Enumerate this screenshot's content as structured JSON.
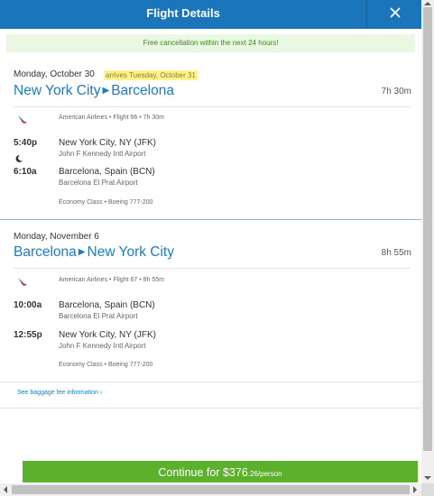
{
  "header": {
    "title": "Flight Details",
    "close_icon": "close-icon"
  },
  "banner": {
    "text": "Free cancellation within the next 24 hours!"
  },
  "outbound": {
    "date": "Monday, October 30",
    "arrives": "arrives Tuesday, October 31",
    "from": "New York City",
    "to": "Barcelona",
    "duration": "7h 30m",
    "airline": "American Airlines • Flight 66 • 7h 30m",
    "depart_time": "5:40p",
    "depart_city": "New York City, NY (JFK)",
    "depart_airport": "John F Kennedy Intl Airport",
    "arrive_time": "6:10a",
    "arrive_city": "Barcelona, Spain (BCN)",
    "arrive_airport": "Barcelona El Prat Airport",
    "cabin": "Economy Class • Boeing 777-200"
  },
  "return": {
    "date": "Monday, November 6",
    "from": "Barcelona",
    "to": "New York City",
    "duration": "8h 55m",
    "airline": "American Airlines • Flight 67 • 8h 55m",
    "depart_time": "10:00a",
    "depart_city": "Barcelona, Spain (BCN)",
    "depart_airport": "Barcelona El Prat Airport",
    "arrive_time": "12:55p",
    "arrive_city": "New York City, NY (JFK)",
    "arrive_airport": "John F Kennedy Intl Airport",
    "cabin": "Economy Class • Boeing 777-200"
  },
  "baggage_link": "See baggage fee information",
  "baggage_chevron": "›",
  "continue": {
    "label": "Continue for $376",
    "cents_suffix": ".26/person"
  },
  "colors": {
    "header": "#1a75bb",
    "accent": "#1a7cc1",
    "continue": "#5bb02c",
    "banner_text": "#3c8a1a"
  }
}
